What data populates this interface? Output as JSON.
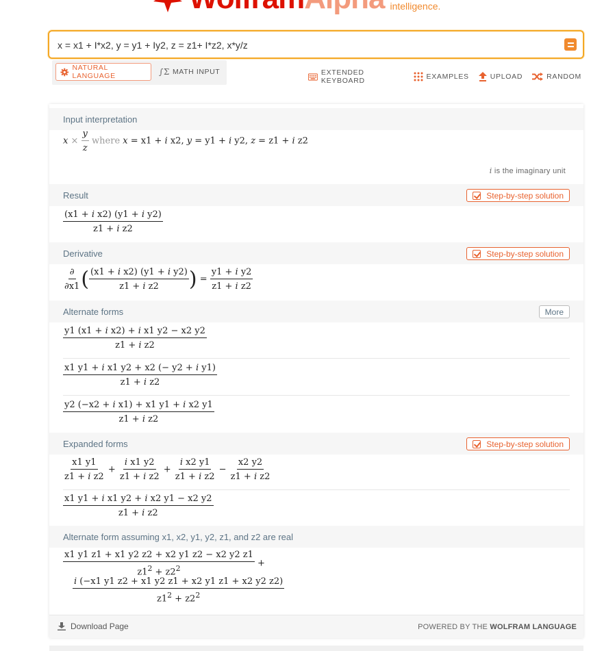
{
  "brand": {
    "name_a": "Wolfram",
    "name_b": "Alpha",
    "tagline": "intelligence."
  },
  "search": {
    "value": "x = x1 + I*x2, y = y1 + Iy2, z = z1+ I*z2, x*y/z"
  },
  "modes": {
    "natural": "NATURAL LANGUAGE",
    "math": "MATH INPUT"
  },
  "tools": {
    "keyboard": "EXTENDED KEYBOARD",
    "examples": "EXAMPLES",
    "upload": "UPLOAD",
    "random": "RANDOM"
  },
  "pods": {
    "input": {
      "title": "Input interpretation",
      "note_i": "i",
      "note_text": "is the imaginary unit"
    },
    "result": {
      "title": "Result",
      "button": "Step-by-step solution"
    },
    "derivative": {
      "title": "Derivative",
      "button": "Step-by-step solution"
    },
    "alternate": {
      "title": "Alternate forms",
      "button": "More"
    },
    "expanded": {
      "title": "Expanded forms",
      "button": "Step-by-step solution"
    },
    "real": {
      "title": "Alternate form assuming x1, x2, y1, y2, z1, and z2 are real"
    }
  },
  "footer": {
    "download": "Download Page",
    "powered_prefix": "POWERED BY THE",
    "powered_brand": "WOLFRAM LANGUAGE"
  },
  "colors": {
    "accent": "#e8622f",
    "brand_red": "#dd1100",
    "search_border": "#f4a825",
    "pod_label": "#5d7485"
  },
  "icons": [
    "gear-icon",
    "math-input-icon",
    "keyboard-icon",
    "examples-grid-icon",
    "upload-icon",
    "random-icon",
    "download-icon",
    "checkbox-icon"
  ]
}
